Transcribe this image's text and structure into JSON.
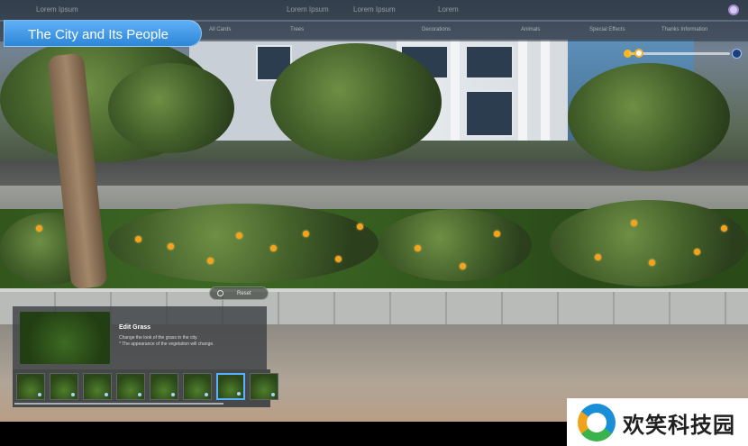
{
  "app": {
    "title": "The City and Its People"
  },
  "top_menu": [
    {
      "label": "Lorem Ipsum"
    },
    {
      "label": "Lorem Ipsum"
    },
    {
      "label": "Lorem Ipsum"
    },
    {
      "label": "Lorem"
    }
  ],
  "categories": [
    {
      "label": "All Cards"
    },
    {
      "label": "Trees"
    },
    {
      "label": "Decorations"
    },
    {
      "label": "Animals"
    },
    {
      "label": "Special Effects"
    },
    {
      "label": "Thanks Information"
    }
  ],
  "time_of_day": {
    "icons": {
      "start": "sun-icon",
      "end": "moon-icon"
    },
    "value_fraction": 0.1
  },
  "panel": {
    "reset_label": "Reset",
    "edit_title": "Edit Grass",
    "edit_desc_1": "Change the look of the grass in the city.",
    "edit_desc_2": "* The appearance of the vegetation will change.",
    "thumbnails_count": 8,
    "selected_thumbnail_index": 6
  },
  "watermark": {
    "text": "欢笑科技园"
  },
  "colors": {
    "title_pill": "#2d86d8",
    "selection": "#57b3ff",
    "slider_fill": "#f2c24a"
  }
}
